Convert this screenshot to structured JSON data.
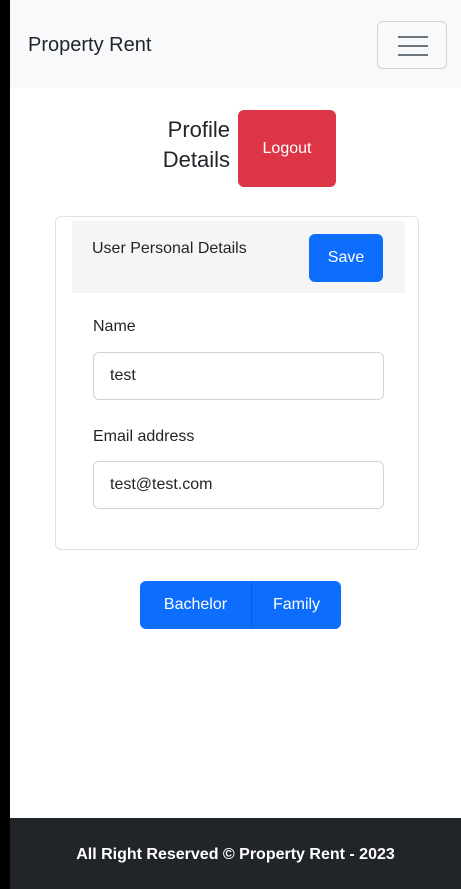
{
  "navbar": {
    "brand": "Property Rent",
    "toggler_icon": "hamburger-menu-icon"
  },
  "profile": {
    "title_line1": "Profile",
    "title_line2": "Details",
    "logout_label": "Logout"
  },
  "card": {
    "header_title": "User Personal Details",
    "save_label": "Save",
    "name_label": "Name",
    "name_value": "test",
    "email_label": "Email address",
    "email_value": "test@test.com"
  },
  "filters": {
    "bachelor_label": "Bachelor",
    "family_label": "Family"
  },
  "footer": {
    "text": "All Right Reserved © Property Rent - 2023"
  },
  "colors": {
    "primary": "#0d6efd",
    "danger": "#dc3545",
    "navbar_bg": "#f8f9fa",
    "footer_bg": "#212529"
  }
}
